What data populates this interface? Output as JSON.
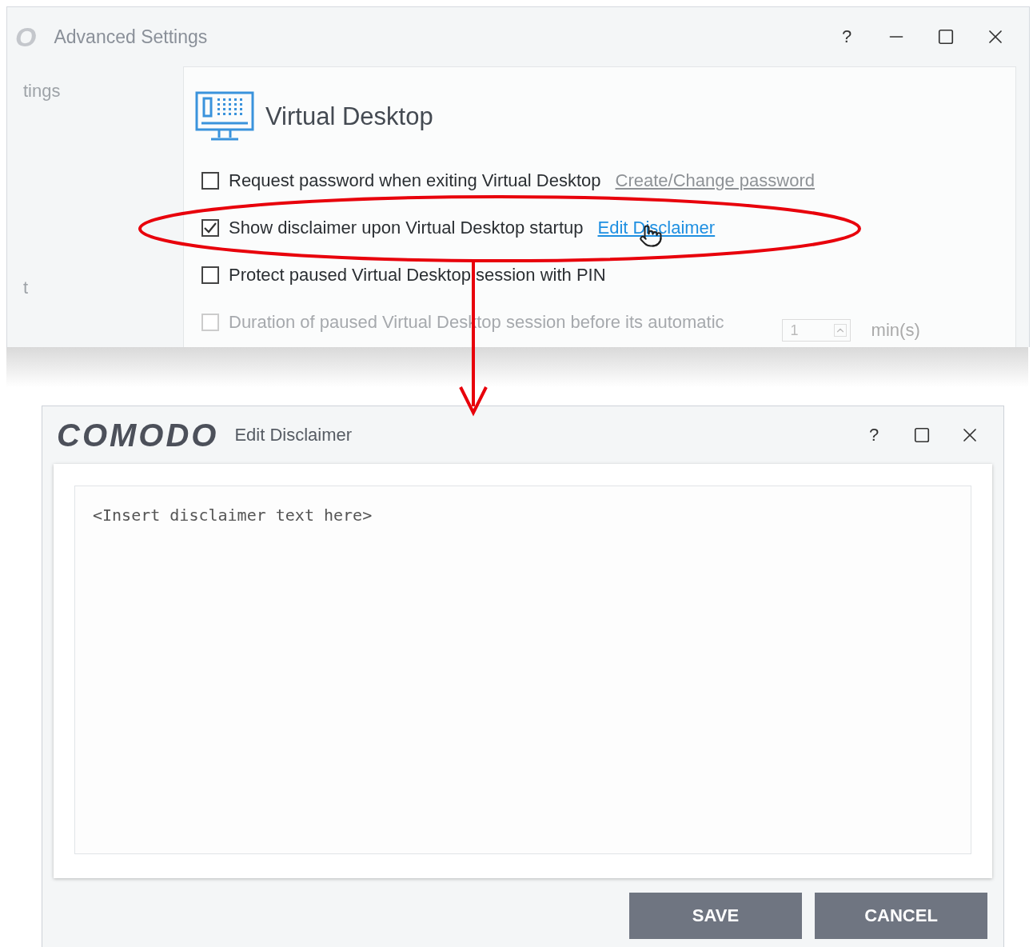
{
  "main_window": {
    "logo_fragment": "O",
    "title": "Advanced Settings",
    "controls": [
      "?"
    ],
    "sidebar_items": [
      "tings",
      "t"
    ],
    "section": {
      "title": "Virtual Desktop"
    },
    "options": [
      {
        "kind": "link",
        "label": "Request password when exiting Virtual Desktop",
        "checked": false,
        "disabled": false,
        "link": {
          "text": "Create/Change password",
          "disabled": true
        }
      },
      {
        "kind": "link",
        "label": "Show disclaimer upon Virtual Desktop startup",
        "checked": true,
        "disabled": false,
        "link": {
          "text": "Edit Disclaimer",
          "disabled": false
        }
      },
      {
        "kind": "plain",
        "label": "Protect paused Virtual Desktop session with PIN",
        "checked": false,
        "disabled": false
      },
      {
        "kind": "spinner",
        "label": "Duration of paused Virtual Desktop session before its automatic",
        "checked": false,
        "disabled": true,
        "value": "1",
        "unit": "min(s)"
      }
    ]
  },
  "dialog": {
    "logo": "COMODO",
    "title": "Edit Disclaimer",
    "controls": [
      "?"
    ],
    "text": "<Insert disclaimer text here>",
    "buttons": [
      "SAVE",
      "CANCEL"
    ]
  }
}
